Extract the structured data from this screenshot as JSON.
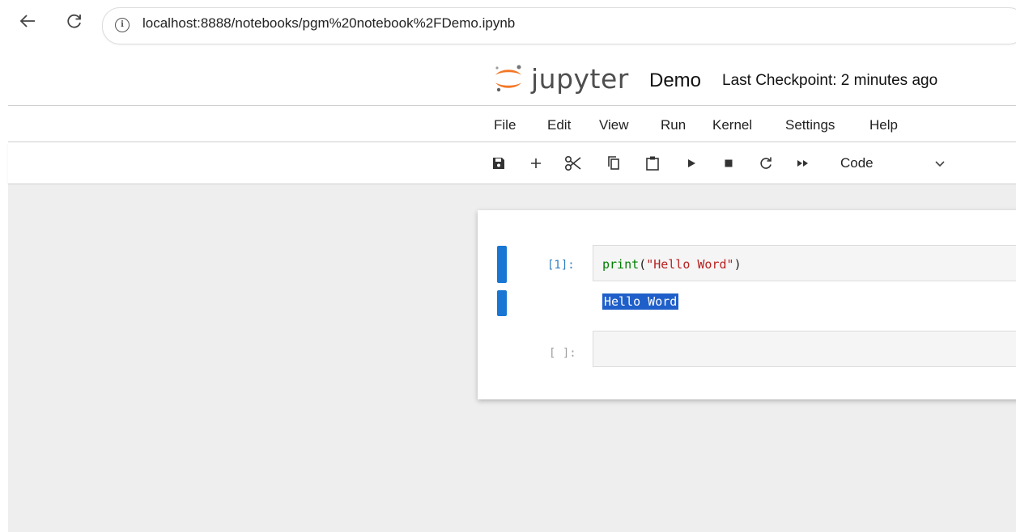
{
  "browser": {
    "url": "localhost:8888/notebooks/pgm%20notebook%2FDemo.ipynb"
  },
  "header": {
    "brand": "jupyter",
    "notebook_name": "Demo",
    "checkpoint": "Last Checkpoint: 2 minutes ago"
  },
  "menu": {
    "items": [
      "File",
      "Edit",
      "View",
      "Run",
      "Kernel",
      "Settings",
      "Help"
    ]
  },
  "toolbar": {
    "icons": [
      "save-icon",
      "plus-icon",
      "scissors-icon",
      "copy-icon",
      "paste-icon",
      "play-icon",
      "stop-icon",
      "restart-icon",
      "fast-forward-icon"
    ],
    "cell_type": "Code"
  },
  "cells": [
    {
      "prompt": "[1]:",
      "code_func": "print",
      "code_open": "(",
      "code_string": "\"Hello Word\"",
      "code_close": ")",
      "output": "Hello Word"
    },
    {
      "prompt": "[ ]:",
      "code": ""
    }
  ],
  "colors": {
    "accent": "#1976d2",
    "selection": "#1f5fc9",
    "prompt": "#307fc1"
  }
}
